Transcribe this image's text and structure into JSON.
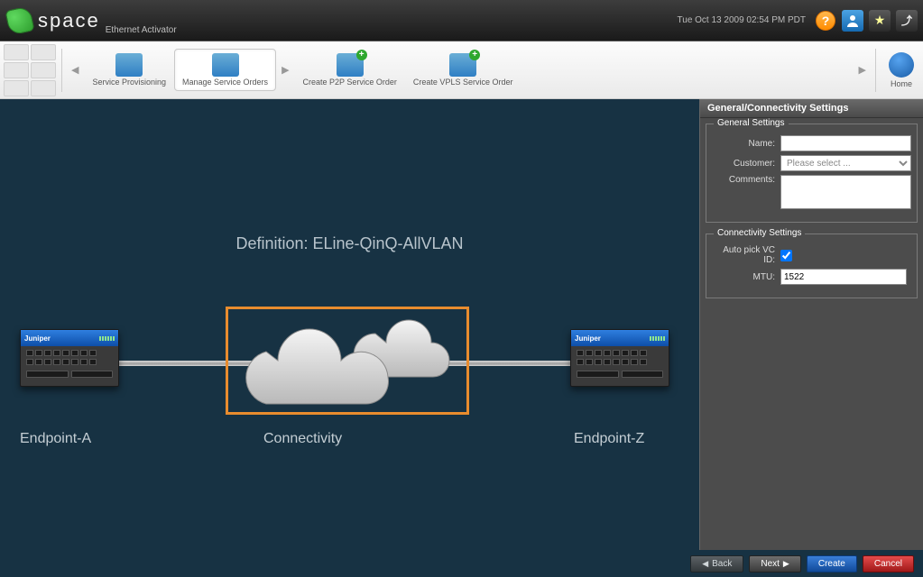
{
  "header": {
    "app_title": "space",
    "sub_title": "Ethernet Activator",
    "timestamp": "Tue Oct 13 2009 02:54 PM PDT"
  },
  "toolbar": {
    "service_provisioning": "Service Provisioning",
    "manage_service_orders": "Manage Service Orders",
    "create_p2p": "Create P2P Service Order",
    "create_vpls": "Create VPLS Service Order",
    "home": "Home"
  },
  "canvas": {
    "definition_prefix": "Definition: ",
    "definition_value": "ELine-QinQ-AllVLAN",
    "endpoint_a": "Endpoint-A",
    "connectivity": "Connectivity",
    "endpoint_z": "Endpoint-Z",
    "device_brand": "Juniper"
  },
  "panel": {
    "title": "General/Connectivity Settings",
    "general_legend": "General Settings",
    "name_label": "Name:",
    "name_value": "",
    "customer_label": "Customer:",
    "customer_placeholder": "Please select ...",
    "comments_label": "Comments:",
    "comments_value": "",
    "conn_legend": "Connectivity Settings",
    "autopick_label": "Auto pick VC ID:",
    "autopick_checked": true,
    "mtu_label": "MTU:",
    "mtu_value": "1522"
  },
  "buttons": {
    "back": "Back",
    "next": "Next",
    "create": "Create",
    "cancel": "Cancel"
  }
}
